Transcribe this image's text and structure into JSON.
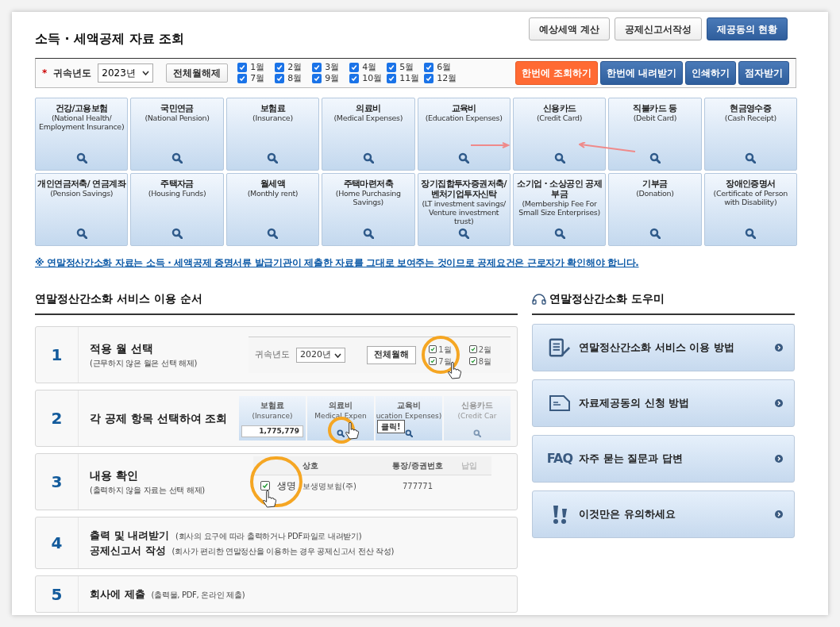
{
  "title": "소득 · 세액공제 자료 조회",
  "top_buttons": [
    {
      "label": "예상세액 계산",
      "kind": "plain"
    },
    {
      "label": "공제신고서작성",
      "kind": "plain"
    },
    {
      "label": "제공동의 현황",
      "kind": "primary"
    }
  ],
  "filter": {
    "required_mark": "*",
    "year_label": "귀속년도",
    "year_value": "2023년",
    "clear_button": "전체월해제",
    "months": [
      {
        "label": "1월",
        "checked": true
      },
      {
        "label": "2월",
        "checked": true
      },
      {
        "label": "3월",
        "checked": true
      },
      {
        "label": "4월",
        "checked": true
      },
      {
        "label": "5월",
        "checked": true
      },
      {
        "label": "6월",
        "checked": true
      },
      {
        "label": "7월",
        "checked": true
      },
      {
        "label": "8월",
        "checked": true
      },
      {
        "label": "9월",
        "checked": true
      },
      {
        "label": "10월",
        "checked": true
      },
      {
        "label": "11월",
        "checked": true
      },
      {
        "label": "12월",
        "checked": true
      }
    ],
    "actions": [
      {
        "label": "한번에 조회하기",
        "kind": "accent"
      },
      {
        "label": "한번에 내려받기",
        "kind": "primary"
      },
      {
        "label": "인쇄하기",
        "kind": "primary"
      },
      {
        "label": "점자받기",
        "kind": "primary"
      }
    ]
  },
  "tiles": [
    {
      "title": "건강/고용보험",
      "subtitle": "(National Health/ Employment Insurance)"
    },
    {
      "title": "국민연금",
      "subtitle": "(National Pension)"
    },
    {
      "title": "보험료",
      "subtitle": "(Insurance)"
    },
    {
      "title": "의료비",
      "subtitle": "(Medical Expenses)"
    },
    {
      "title": "교육비",
      "subtitle": "(Education Expenses)"
    },
    {
      "title": "신용카드",
      "subtitle": "(Credit Card)"
    },
    {
      "title": "직불카드 등",
      "subtitle": "(Debit Card)"
    },
    {
      "title": "현금영수증",
      "subtitle": "(Cash Receipt)"
    },
    {
      "title": "개인연금저축/ 연금계좌",
      "subtitle": "(Pension Savings)"
    },
    {
      "title": "주택자금",
      "subtitle": "(Housing Funds)"
    },
    {
      "title": "월세액",
      "subtitle": "(Monthly rent)"
    },
    {
      "title": "주택마련저축",
      "subtitle": "(Home Purchasing Savings)"
    },
    {
      "title": "장기집합투자증권저축/ 벤처기업투자신탁",
      "subtitle": "(LT investment savings/ Venture investment trust)"
    },
    {
      "title": "소기업 · 소상공인 공제부금",
      "subtitle": "(Membership Fee For Small Size Enterprises)"
    },
    {
      "title": "기부금",
      "subtitle": "(Donation)"
    },
    {
      "title": "장애인증명서",
      "subtitle": "(Certificate of Person with Disability)"
    }
  ],
  "notice": "※ 연말정산간소화 자료는 소득 · 세액공제 증명서류 발급기관이 제출한 자료를 그대로 보여주는 것이므로 공제요건은 근로자가 확인해야 합니다.",
  "steps_heading": "연말정산간소화 서비스 이용 순서",
  "steps": [
    {
      "number": "1",
      "kind": "stacked",
      "lines": [
        {
          "title": "적용 월 선택",
          "note": "(근무하지 않은 월은 선택 해제)"
        }
      ],
      "illustration": {
        "kind": "months",
        "year_label": "귀속년도",
        "year_value": "2020년",
        "button": "전체월해",
        "months": [
          {
            "label": "1월",
            "checked": true
          },
          {
            "label": "7월",
            "checked": true
          },
          {
            "label": "2월",
            "checked": true
          },
          {
            "label": "8월",
            "checked": true
          }
        ]
      }
    },
    {
      "number": "2",
      "kind": "stacked",
      "lines": [
        {
          "title": "각 공제 항목 선택하여 조회"
        }
      ],
      "illustration": {
        "kind": "tiles",
        "tiles": [
          {
            "title": "보험료",
            "subtitle": "(Insurance)",
            "amount": "1,775,779"
          },
          {
            "title": "의료비",
            "subtitle": "Medical Expen"
          },
          {
            "title": "교육비",
            "subtitle": "ucation Expenses)"
          },
          {
            "title": "신용카드",
            "subtitle": "(Credit Car"
          }
        ],
        "callout": "클릭!"
      }
    },
    {
      "number": "3",
      "kind": "stacked",
      "lines": [
        {
          "title": "내용 확인",
          "note": "(출력하지 않을 자료는 선택 해제)"
        }
      ],
      "illustration": {
        "kind": "table",
        "columns": [
          "상호",
          "통장/증권번호",
          "납입"
        ],
        "magnified_text": "생명",
        "rows": [
          {
            "checked": true,
            "cells": [
              "보생명보험(주)",
              "777771"
            ]
          }
        ]
      }
    },
    {
      "number": "4",
      "kind": "inline",
      "lines": [
        {
          "title": "출력 및 내려받기",
          "note": "(회사의 요구에 따라 출력하거나 PDF파일로 내려받기)"
        },
        {
          "title": "공제신고서 작성",
          "note": "(회사가 편리한 연말정산을 이용하는 경우 공제신고서 전산 작성)"
        }
      ]
    },
    {
      "number": "5",
      "kind": "inline",
      "lines": [
        {
          "title": "회사에 제출",
          "note": "(출력물, PDF, 온라인 제출)"
        }
      ]
    }
  ],
  "helper_heading": "연말정산간소화 도우미",
  "helpers": [
    {
      "kind": "guide",
      "label": "연말정산간소화 서비스 이용 방법"
    },
    {
      "kind": "application",
      "label": "자료제공동의 신청 방법"
    },
    {
      "kind": "faq",
      "icon_text": "FAQ",
      "label": "자주 묻는 질문과 답변"
    },
    {
      "kind": "caution",
      "label": "이것만은 유의하세요"
    }
  ]
}
